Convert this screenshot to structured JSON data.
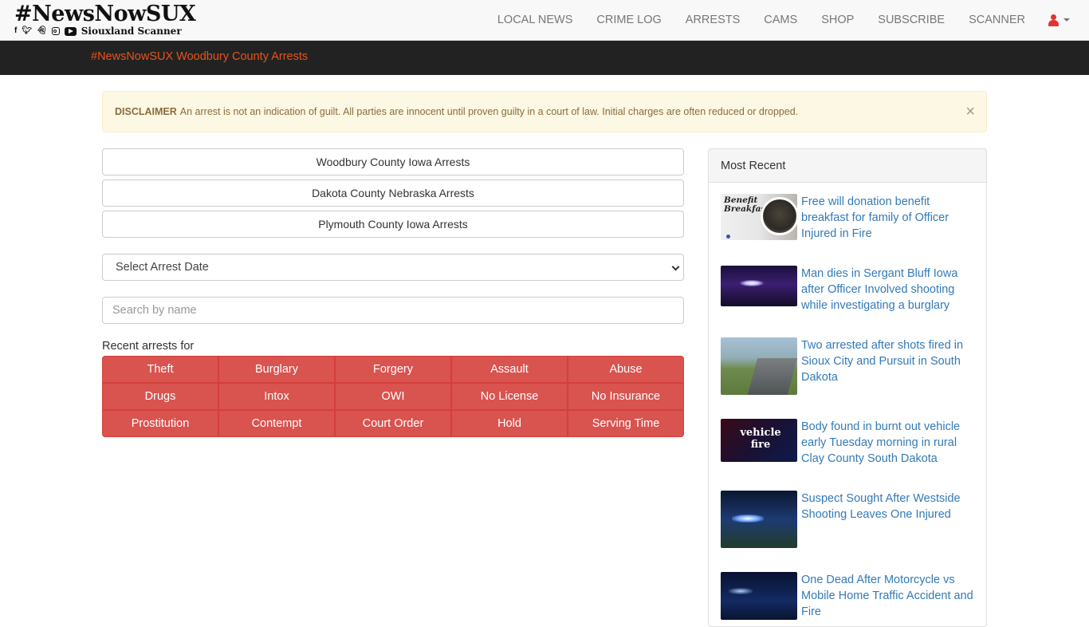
{
  "navbar": {
    "brand_title": "#NewsNowSUX",
    "brand_subtitle": "Siouxland Scanner",
    "social_icons": [
      "facebook-icon",
      "twitter-icon",
      "snapchat-icon",
      "instagram-icon",
      "youtube-icon"
    ],
    "links": [
      "LOCAL NEWS",
      "CRIME LOG",
      "ARRESTS",
      "CAMS",
      "SHOP",
      "SUBSCRIBE",
      "SCANNER"
    ],
    "user_icon": "user-icon",
    "accent_color": "#e1332e"
  },
  "subheader": {
    "title": "#NewsNowSUX Woodbury County Arrests",
    "title_color": "#e8541d"
  },
  "disclaimer": {
    "label": "DISCLAIMER",
    "text": "An arrest is not an indication of guilt. All parties are innocent until proven guilty in a court of law. Initial charges are often reduced or dropped.",
    "close": "×"
  },
  "counties": [
    "Woodbury County Iowa Arrests",
    "Dakota County Nebraska Arrests",
    "Plymouth County Iowa Arrests"
  ],
  "arrest_date_select": {
    "selected": "Select Arrest Date"
  },
  "search": {
    "placeholder": "Search by name",
    "value": ""
  },
  "recent": {
    "label": "Recent arrests for",
    "categories": [
      "Theft",
      "Burglary",
      "Forgery",
      "Assault",
      "Abuse",
      "Drugs",
      "Intox",
      "OWI",
      "No License",
      "No Insurance",
      "Prostitution",
      "Contempt",
      "Court Order",
      "Hold",
      "Serving Time"
    ],
    "button_color": "#d9534f"
  },
  "most_recent": {
    "heading": "Most Recent",
    "items": [
      {
        "title": "Free will donation benefit breakfast for family of Officer Injured in Fire",
        "thumb_text": "Benefit Breakfast"
      },
      {
        "title": "Man dies in Sergant Bluff Iowa after Officer Involved shooting while investigating a burglary"
      },
      {
        "title": "Two arrested after shots fired in Sioux City and Pursuit in South Dakota"
      },
      {
        "title": "Body found in burnt out vehicle early Tuesday morning in rural Clay County South Dakota",
        "thumb_text": "vehicle fire"
      },
      {
        "title": "Suspect Sought After Westside Shooting Leaves One Injured"
      },
      {
        "title": "One Dead After Motorcycle vs Mobile Home Traffic Accident and Fire"
      }
    ],
    "link_color": "#337ab7"
  }
}
